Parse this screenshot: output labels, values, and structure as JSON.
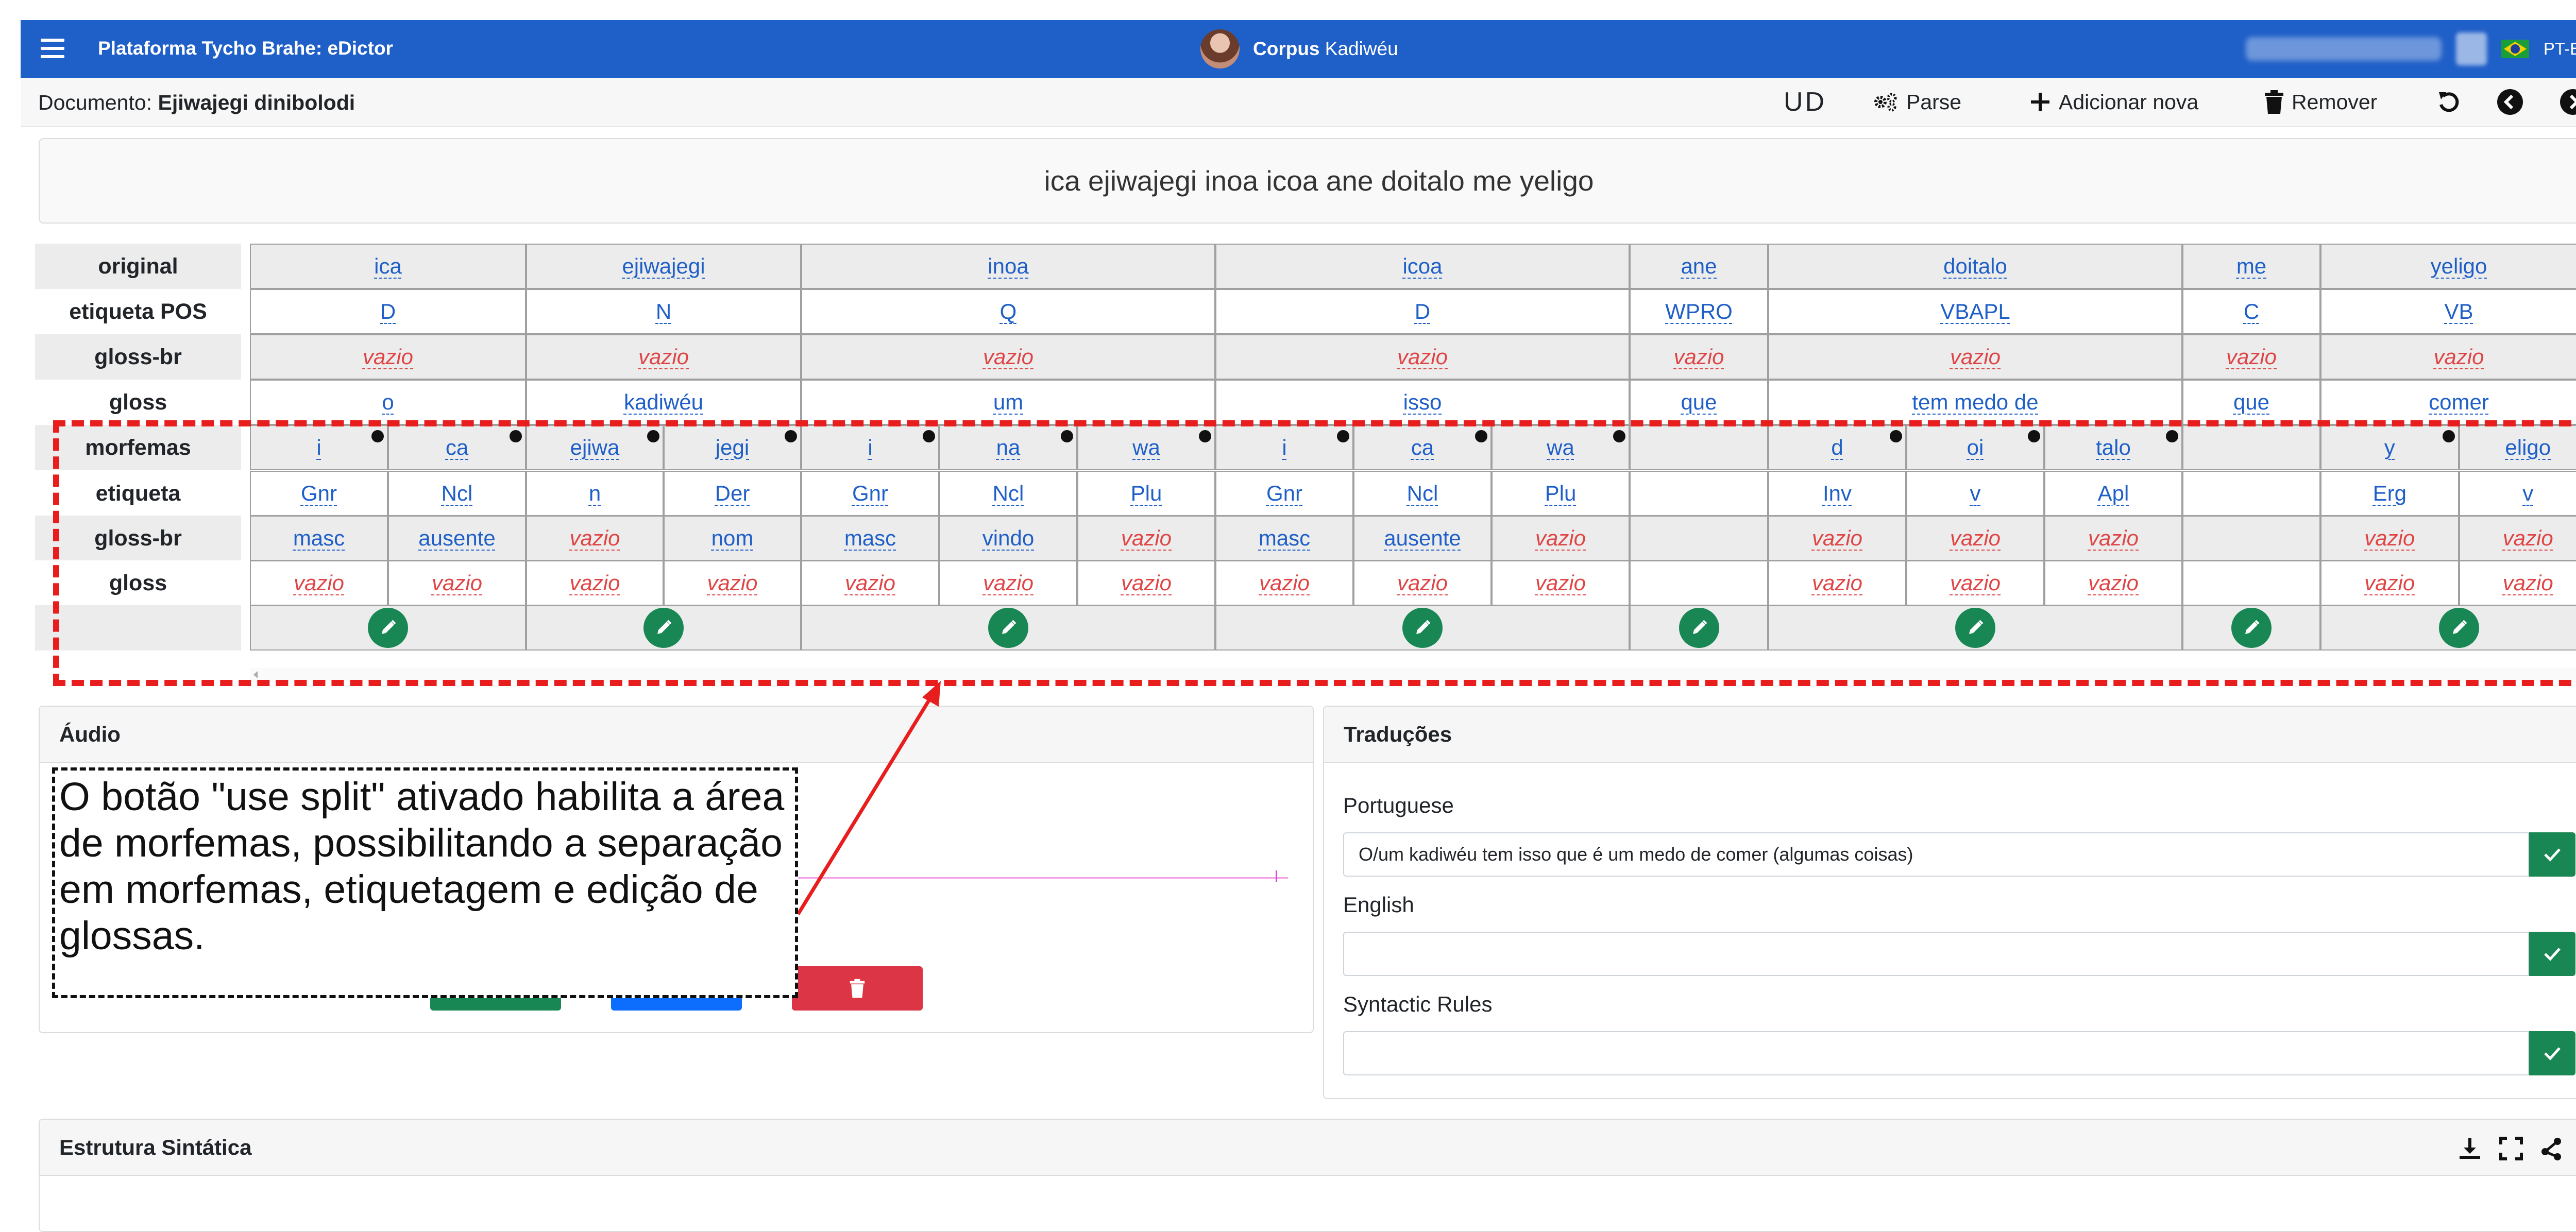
{
  "navbar": {
    "title": "Plataforma Tycho Brahe: eDictor",
    "corpus_label": "Corpus",
    "corpus_name": "Kadiwéu",
    "language": "PT-BR"
  },
  "docbar": {
    "label": "Documento:",
    "name": "Ejiwajegi dinibolodi",
    "ud": "UD",
    "parse": "Parse",
    "add": "Adicionar nova",
    "remove": "Remover"
  },
  "sentence": "ica ejiwajegi inoa icoa ane doitalo me yeligo",
  "row_labels": {
    "original": "original",
    "pos": "etiqueta POS",
    "glossbr": "gloss-br",
    "gloss": "gloss",
    "morfemas": "morfemas",
    "etiqueta": "etiqueta",
    "m_glossbr": "gloss-br",
    "m_gloss": "gloss"
  },
  "empty_value": "vazio",
  "words": [
    {
      "original": "ica",
      "pos": "D",
      "glossbr": "",
      "gloss": "o",
      "morphemes": [
        {
          "m": "i",
          "tag": "Gnr",
          "gbr": "masc",
          "g": ""
        },
        {
          "m": "ca",
          "tag": "Ncl",
          "gbr": "ausente",
          "g": ""
        }
      ]
    },
    {
      "original": "ejiwajegi",
      "pos": "N",
      "glossbr": "",
      "gloss": "kadiwéu",
      "morphemes": [
        {
          "m": "ejiwa",
          "tag": "n",
          "gbr": "",
          "g": ""
        },
        {
          "m": "jegi",
          "tag": "Der",
          "gbr": "nom",
          "g": ""
        }
      ]
    },
    {
      "original": "inoa",
      "pos": "Q",
      "glossbr": "",
      "gloss": "um",
      "morphemes": [
        {
          "m": "i",
          "tag": "Gnr",
          "gbr": "masc",
          "g": ""
        },
        {
          "m": "na",
          "tag": "Ncl",
          "gbr": "vindo",
          "g": ""
        },
        {
          "m": "wa",
          "tag": "Plu",
          "gbr": "",
          "g": ""
        }
      ]
    },
    {
      "original": "icoa",
      "pos": "D",
      "glossbr": "",
      "gloss": "isso",
      "morphemes": [
        {
          "m": "i",
          "tag": "Gnr",
          "gbr": "masc",
          "g": ""
        },
        {
          "m": "ca",
          "tag": "Ncl",
          "gbr": "ausente",
          "g": ""
        },
        {
          "m": "wa",
          "tag": "Plu",
          "gbr": "",
          "g": ""
        }
      ]
    },
    {
      "original": "ane",
      "pos": "WPRO",
      "glossbr": "",
      "gloss": "que",
      "morphemes": [
        {
          "m": "",
          "tag": "",
          "gbr": "-",
          "g": "-"
        }
      ]
    },
    {
      "original": "doitalo",
      "pos": "VBAPL",
      "glossbr": "",
      "gloss": "tem medo de",
      "morphemes": [
        {
          "m": "d",
          "tag": "Inv",
          "gbr": "",
          "g": ""
        },
        {
          "m": "oi",
          "tag": "v",
          "gbr": "",
          "g": ""
        },
        {
          "m": "talo",
          "tag": "Apl",
          "gbr": "",
          "g": ""
        }
      ]
    },
    {
      "original": "me",
      "pos": "C",
      "glossbr": "",
      "gloss": "que",
      "morphemes": [
        {
          "m": "",
          "tag": "",
          "gbr": "-",
          "g": "-"
        }
      ]
    },
    {
      "original": "yeligo",
      "pos": "VB",
      "glossbr": "",
      "gloss": "comer",
      "morphemes": [
        {
          "m": "y",
          "tag": "Erg",
          "gbr": "",
          "g": ""
        },
        {
          "m": "eligo",
          "tag": "v",
          "gbr": "",
          "g": ""
        }
      ]
    }
  ],
  "audio": {
    "title": "Áudio"
  },
  "translations": {
    "title": "Traduções",
    "fields": [
      {
        "label": "Portuguese",
        "value": "O/um kadiwéu tem isso que é um medo de comer (algumas coisas)"
      },
      {
        "label": "English",
        "value": ""
      },
      {
        "label": "Syntactic Rules",
        "value": ""
      }
    ]
  },
  "syntax": {
    "title": "Estrutura Sintática"
  },
  "annotation": {
    "note": "O botão \"use split\" ativado habilita a área de morfemas, possibilitando a separação em morfemas, etiquetagem e edição de glossas."
  },
  "colors": {
    "navbar": "#1f5fc8",
    "link": "#1f5fc8",
    "empty": "#e04545",
    "success": "#198754",
    "primary": "#0d6efd",
    "danger": "#dc3545",
    "highlight": "#e81e1e"
  }
}
